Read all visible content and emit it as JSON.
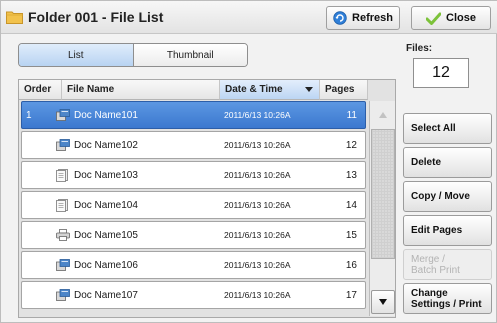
{
  "window": {
    "title": "Folder 001 - File List",
    "refresh_label": "Refresh",
    "close_label": "Close"
  },
  "view_toggle": {
    "options": [
      "List",
      "Thumbnail"
    ],
    "selected": "List"
  },
  "table": {
    "columns": {
      "order": "Order",
      "file_name": "File Name",
      "date_time": "Date & Time",
      "pages": "Pages"
    },
    "sort_column": "date_time",
    "rows": [
      {
        "order": "1",
        "icon": "scanned-document-icon",
        "name": "Doc Name101",
        "date": "2011/6/13 10:26A",
        "pages": "11",
        "selected": true
      },
      {
        "order": "",
        "icon": "scanned-document-icon",
        "name": "Doc Name102",
        "date": "2011/6/13 10:26A",
        "pages": "12",
        "selected": false
      },
      {
        "order": "",
        "icon": "document-icon",
        "name": "Doc Name103",
        "date": "2011/6/13 10:26A",
        "pages": "13",
        "selected": false
      },
      {
        "order": "",
        "icon": "document-icon",
        "name": "Doc Name104",
        "date": "2011/6/13 10:26A",
        "pages": "14",
        "selected": false
      },
      {
        "order": "",
        "icon": "printer-icon",
        "name": "Doc Name105",
        "date": "2011/6/13 10:26A",
        "pages": "15",
        "selected": false
      },
      {
        "order": "",
        "icon": "scanned-document-icon",
        "name": "Doc Name106",
        "date": "2011/6/13 10:26A",
        "pages": "16",
        "selected": false
      },
      {
        "order": "",
        "icon": "scanned-document-icon",
        "name": "Doc Name107",
        "date": "2011/6/13 10:26A",
        "pages": "17",
        "selected": false
      }
    ]
  },
  "files": {
    "label": "Files:",
    "count": "12"
  },
  "actions": {
    "select_all": "Select All",
    "delete": "Delete",
    "copy_move": "Copy / Move",
    "edit_pages": "Edit Pages",
    "merge_line1": "Merge /",
    "merge_line2": "Batch Print",
    "change_line1": "Change",
    "change_line2": "Settings / Print"
  },
  "colors": {
    "selected_row": "#3b78cf",
    "active_toggle": "#b8d3f2",
    "refresh_icon": "#2f7fd8",
    "close_icon": "#7cc23a",
    "folder_icon": "#f2c24c"
  }
}
